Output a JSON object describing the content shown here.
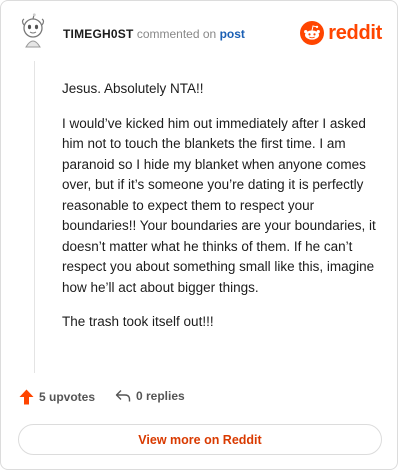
{
  "header": {
    "username": "TIMEGH0ST",
    "action_text": "commented on",
    "post_link": "post",
    "brand": "reddit"
  },
  "comment": {
    "paragraphs": [
      "Jesus. Absolutely NTA!!",
      "I would’ve kicked him out immediately after I asked him not to touch the blankets the first time. I am paranoid so I hide my blanket when anyone comes over, but if it’s someone you’re dating it is perfectly reasonable to expect them to respect your boundaries!! Your boundaries are your boundaries, it doesn’t matter what he thinks of them. If he can’t respect you about something small like this, imagine how he’ll act about bigger things.",
      "The trash took itself out!!!"
    ]
  },
  "footer": {
    "upvotes": "5 upvotes",
    "replies": "0 replies",
    "upvote_icon": "arrow-up-icon",
    "reply_icon": "reply-arrow-icon"
  },
  "cta": {
    "label": "View more on Reddit"
  },
  "colors": {
    "brand": "#ff4500",
    "link": "#1a5fb4",
    "cta": "#d93a00"
  }
}
